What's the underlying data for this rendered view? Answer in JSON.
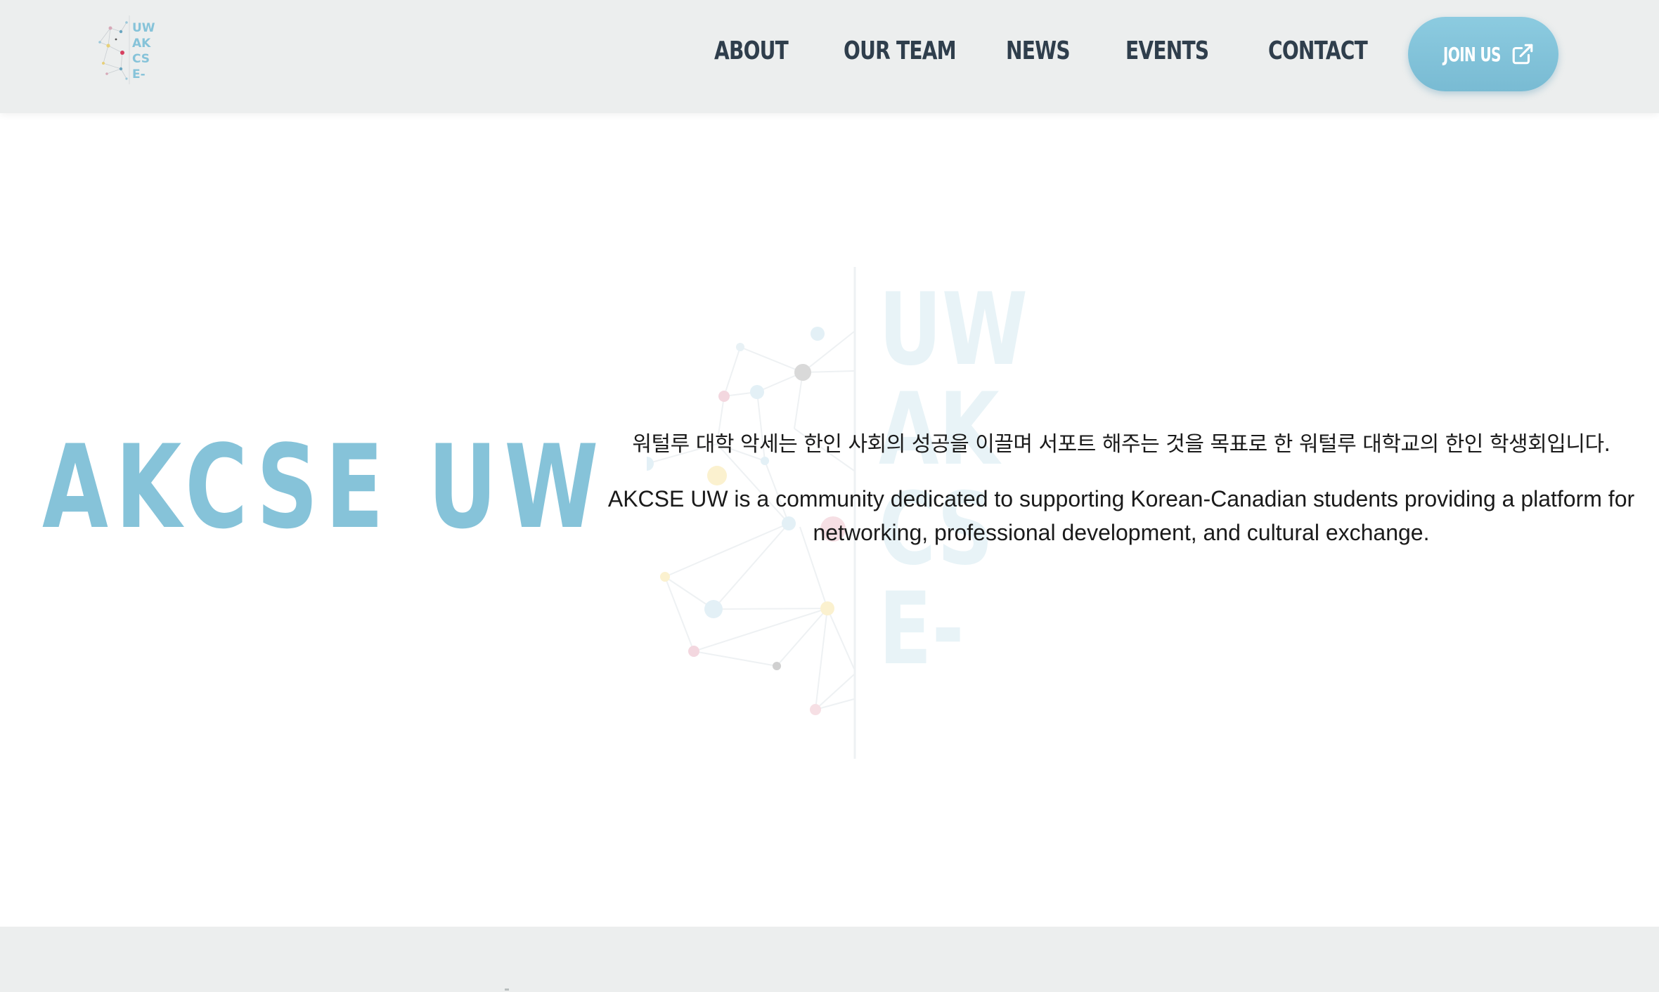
{
  "header": {
    "logo": {
      "icon": "akcse-network-logo",
      "lines": [
        "UW",
        "AK",
        "CS",
        "E-"
      ]
    },
    "nav": [
      {
        "label": "ABOUT"
      },
      {
        "label": "OUR TEAM"
      },
      {
        "label": "NEWS"
      },
      {
        "label": "EVENTS"
      },
      {
        "label": "CONTACT"
      }
    ],
    "join": {
      "label": "JOIN US",
      "icon": "external-link-icon"
    }
  },
  "hero": {
    "title": "AKCSE UW",
    "korean_text": "워털루 대학 악세는 한인 사회의 성공을 이끌며 서포트 해주는 것을 목표로 한 워털루 대학교의 한인 학생회입니다.",
    "english_text": "AKCSE UW is a community dedicated to supporting Korean-Canadian students providing a platform for networking, professional development, and cultural exchange.",
    "watermark": {
      "icon": "akcse-network-watermark",
      "lines": [
        "UW",
        "AK",
        "CS",
        "E-"
      ]
    }
  },
  "colors": {
    "accent": "#86c3d9",
    "nav_text": "#2f3e4c",
    "header_bg": "#eceeee",
    "button_bg": "#80c1d8",
    "body_text": "#1a1a1a"
  }
}
